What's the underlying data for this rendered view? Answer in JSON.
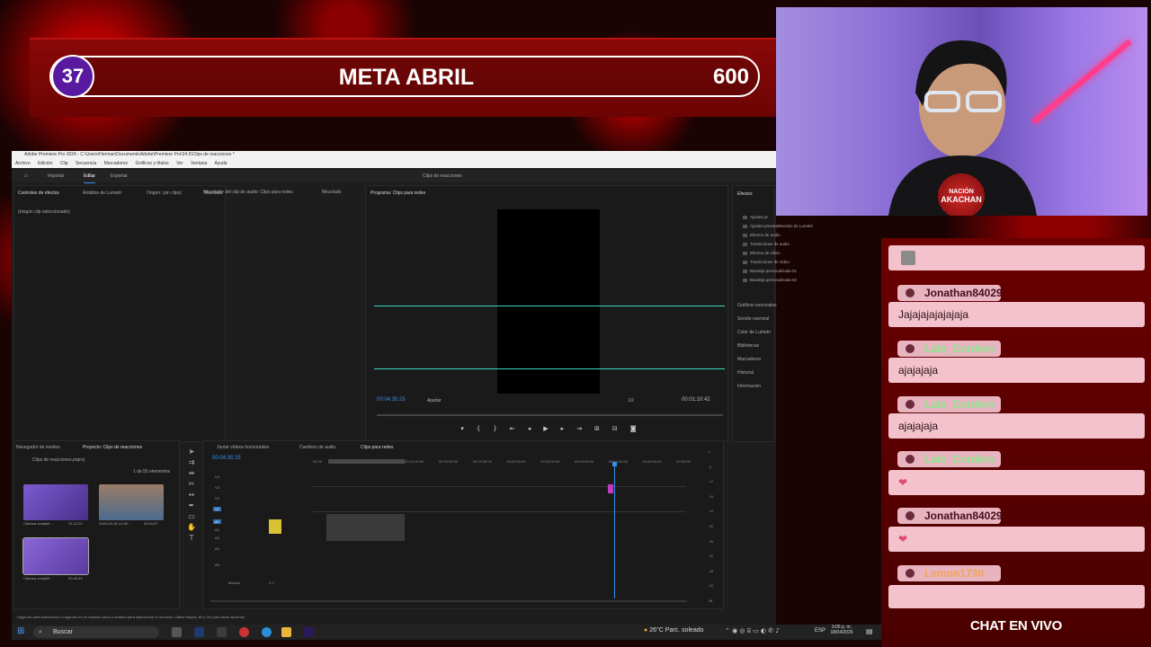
{
  "goal": {
    "start": "37",
    "title": "META ABRIL",
    "end": "600"
  },
  "premiere": {
    "title": "Adobe Premiere Pro 2024 - C:\\Users\\Herman\\Documents\\Adobe\\Premiere Pro\\24.0\\Clips de reacciones *",
    "menu": [
      "Archivo",
      "Edición",
      "Clip",
      "Secuencia",
      "Marcadores",
      "Gráficos y títulos",
      "Ver",
      "Ventana",
      "Ayuda"
    ],
    "workspace_tabs": [
      "Importar",
      "Editar",
      "Exportar"
    ],
    "project_name": "Clips de reacciones",
    "left_panel_tabs": [
      "Controles de efectos",
      "Ámbitos de Lumetri",
      "Origen: (sin clips)",
      "Mezclador del clip de audio: Clips para redes",
      "Mezclado"
    ],
    "no_clip": "(ningún clip seleccionado)",
    "program_tab": "Programa: Clips para redes",
    "program_timecode": "00:04:35:25",
    "fit_label": "Ajustar",
    "zoom_fraction": "1/2",
    "duration": "00:01:10:42",
    "effects_tab": "Efectos",
    "effects_items": [
      "Ajustes pr",
      "Ajustes preestablecidos de Lumetri",
      "Efectos de audio",
      "Transiciones de audio",
      "Efectos de vídeo",
      "Transiciones de vídeo",
      "Bandeja personalizada 01",
      "Bandeja personalizada 02"
    ],
    "side_panels": [
      "Gráficos esenciales",
      "Sonido esencial",
      "Color de Lumetri",
      "Bibliotecas",
      "Marcadores",
      "Historial",
      "Información"
    ],
    "project_tabs": [
      "Navegador de medios",
      "Proyecto: Clips de reacciones"
    ],
    "project_file": "Clips de reacciones.prproj",
    "item_count": "1 de 55 elementos",
    "media": [
      {
        "name": "Cámara complet...",
        "duration": "21:12:22"
      },
      {
        "name": "2026-04-18 14-30...",
        "duration": "20:44:57"
      },
      {
        "name": "Cámara complet...",
        "duration": "20:40:43"
      }
    ],
    "timeline_tabs": [
      "Juntar vídeos horizontales",
      "Cambios de audio",
      "Clips para redes"
    ],
    "timeline_timecode": "00:04:35:25",
    "ruler": [
      "00:00",
      "00:00:30:00",
      "00:01:00:00",
      "00:01:30:00",
      "00:02:00:00",
      "00:02:30:00",
      "00:03:00:00",
      "00:03:30:00",
      "00:04:00:00",
      "00:04:30:00",
      "00:05:00:00",
      "00:05:30"
    ],
    "video_tracks": [
      "V4",
      "V3",
      "V2",
      "V1"
    ],
    "audio_tracks": [
      "A1",
      "A2",
      "A3",
      "A4",
      "A5"
    ],
    "mix_label": "Mezcla",
    "mix_value": "0,0",
    "status": "Haga clic para seleccionar o haga clic en un espacio vacío y arrastre para seleccionar el recuadro. Utilice Mayús, Alt y Ctrl para otras opciones.",
    "meter_labels": [
      "0",
      "-6",
      "-12",
      "-18",
      "-24",
      "-30",
      "-36",
      "-42",
      "-48",
      "-54",
      "dB"
    ]
  },
  "chat": {
    "messages": [
      {
        "name": "",
        "text": ""
      },
      {
        "name": "Jonathan84029",
        "text": "Jajajajajajajaja"
      },
      {
        "name": "Lalo_Cordero",
        "text": "ajajajaja"
      },
      {
        "name": "Lalo_Cordero",
        "text": "ajajajaja"
      },
      {
        "name": "Lalo_Cordero",
        "text": "❤"
      },
      {
        "name": "Jonathan84029",
        "text": "❤"
      },
      {
        "name": "Lemon1730",
        "text": ""
      }
    ],
    "footer": "CHAT EN VIVO"
  },
  "webcam": {
    "logo_top": "NACIÓN",
    "logo_bottom": "AKACHAN"
  },
  "taskbar": {
    "search": "Buscar",
    "weather": "26°C  Parc. soleado",
    "lang": "ESP",
    "time": "3:05 p. m.",
    "date": "18/04/2026"
  },
  "colors": {
    "accent": "#3a8fe8",
    "chat_name_bg": "#e7b4c0",
    "chat_msg_bg": "#f4c2cc",
    "banner": "#7a0606"
  }
}
